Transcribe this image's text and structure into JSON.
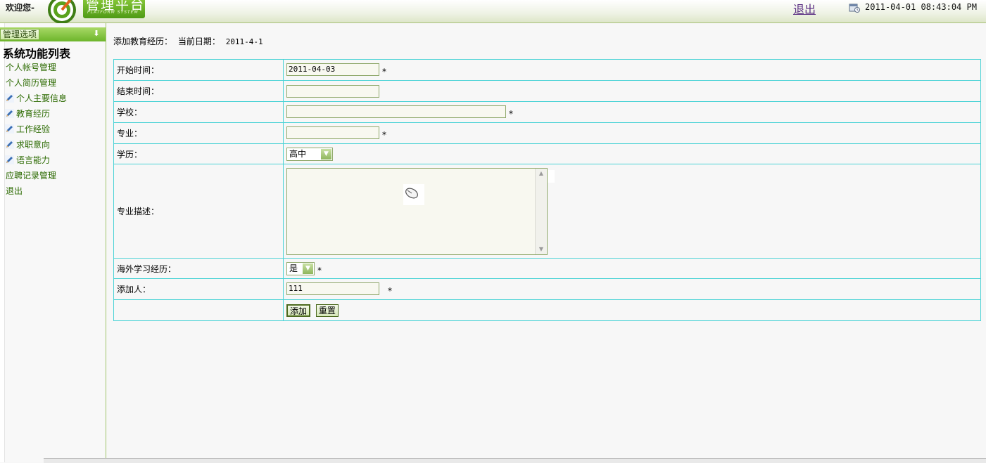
{
  "header": {
    "welcome": "欢迎您-",
    "brand_title": "管理平台",
    "brand_subtitle": "PLATFORM SYSTEM",
    "logout": "退出",
    "datetime": "2011-04-01 08:43:04 PM",
    "colors": {
      "brand_green": "#5ca51f",
      "accent_border": "#a9c27a"
    }
  },
  "sidebar": {
    "options_button": "管理选项",
    "title": "系统功能列表",
    "items": [
      {
        "label": "个人帐号管理",
        "icon": ""
      },
      {
        "label": "个人简历管理",
        "icon": ""
      },
      {
        "label": "个人主要信息",
        "icon": "pencil-icon"
      },
      {
        "label": "教育经历",
        "icon": "pencil-icon"
      },
      {
        "label": "工作经验",
        "icon": "pencil-icon"
      },
      {
        "label": "求职意向",
        "icon": "pencil-icon"
      },
      {
        "label": "语言能力",
        "icon": "pencil-icon"
      },
      {
        "label": "应聘记录管理",
        "icon": ""
      },
      {
        "label": "退出",
        "icon": ""
      }
    ]
  },
  "page": {
    "heading": "添加教育经历：",
    "date_label": "当前日期：",
    "date_value": "2011-4-1"
  },
  "form": {
    "start_label": "开始时间：",
    "start_value": "2011-04-03",
    "end_label": "结束时间：",
    "end_value": "",
    "school_label": "学校：",
    "school_value": "",
    "major_label": "专业：",
    "major_value": "",
    "degree_label": "学历：",
    "degree_value": "高中",
    "desc_label": "专业描述：",
    "desc_value": "",
    "overseas_label": "海外学习经历：",
    "overseas_value": "是",
    "adder_label": "添加人：",
    "adder_value": "111",
    "required_mark": "*",
    "submit": "添加",
    "reset": "重置",
    "colors": {
      "table_border": "#4cd3d6",
      "input_border": "#8fa86a"
    }
  }
}
